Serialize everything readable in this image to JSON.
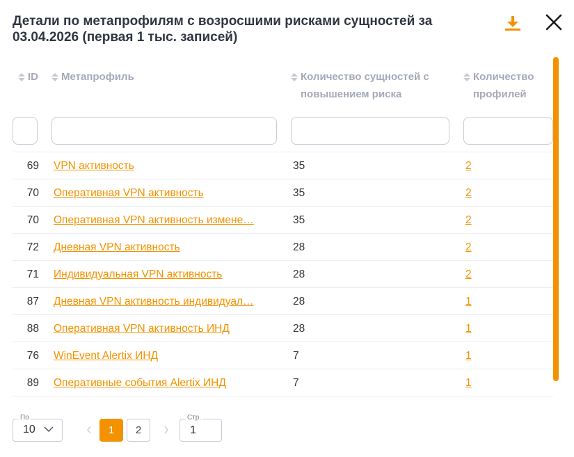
{
  "dialog": {
    "title": "Детали по метапрофилям с возросшими рисками сущностей за 03.04.2026 (первая 1 тыс. записей)",
    "icons": {
      "download": "download-icon",
      "close": "close-icon"
    },
    "accent_color": "#f39200"
  },
  "table": {
    "columns": [
      {
        "key": "id",
        "label": "ID"
      },
      {
        "key": "name",
        "label": "Метапрофиль"
      },
      {
        "key": "count",
        "label": "Количество сущностей с повышением риска"
      },
      {
        "key": "profiles",
        "label": "Количество профилей"
      }
    ],
    "rows": [
      {
        "id": "69",
        "name": "VPN активность",
        "count": "35",
        "profiles": "2"
      },
      {
        "id": "70",
        "name": "Оперативная VPN активность",
        "count": "35",
        "profiles": "2"
      },
      {
        "id": "70",
        "name": "Оперативная VPN активность измене…",
        "count": "35",
        "profiles": "2"
      },
      {
        "id": "72",
        "name": "Дневная VPN активность",
        "count": "28",
        "profiles": "2"
      },
      {
        "id": "71",
        "name": "Индивидуальная VPN активность",
        "count": "28",
        "profiles": "2"
      },
      {
        "id": "87",
        "name": "Дневная VPN активность индивидуал…",
        "count": "28",
        "profiles": "1"
      },
      {
        "id": "88",
        "name": "Оперативная VPN активность ИНД",
        "count": "28",
        "profiles": "1"
      },
      {
        "id": "76",
        "name": "WinEvent Alertix ИНД",
        "count": "7",
        "profiles": "1"
      },
      {
        "id": "89",
        "name": "Оперативные события Alertix ИНД",
        "count": "7",
        "profiles": "1"
      }
    ]
  },
  "pagination": {
    "page_size_label": "По",
    "page_size": "10",
    "pages": [
      "1",
      "2"
    ],
    "current_page": "1",
    "page_input_label": "Стр.",
    "page_input_value": "1"
  }
}
